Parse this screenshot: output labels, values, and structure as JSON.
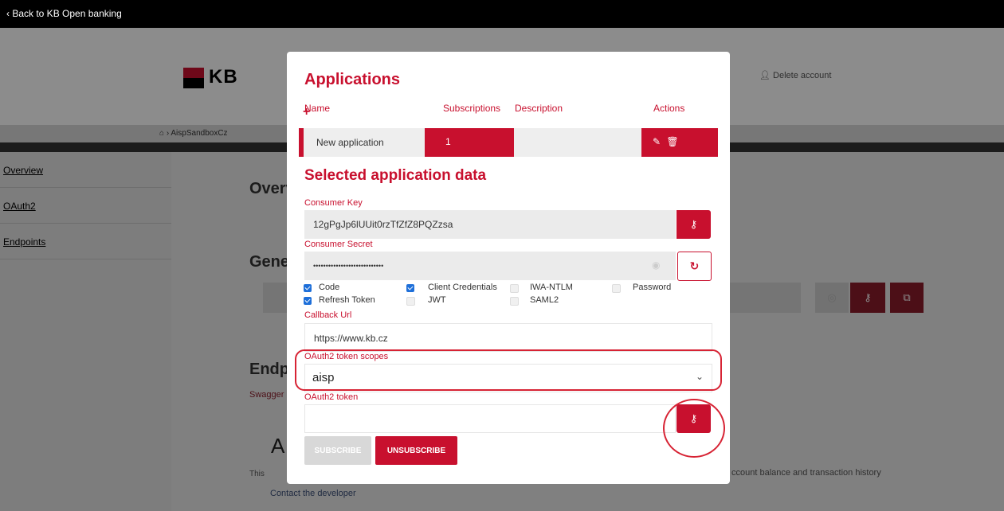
{
  "topbar": {
    "back_label": "‹ Back to KB Open banking"
  },
  "header": {
    "logo_text": "KB",
    "delete_account_label": "Delete account"
  },
  "breadcrumb": {
    "current": "AispSandboxCz"
  },
  "sidebar": {
    "items": [
      {
        "label": "Overview"
      },
      {
        "label": "OAuth2"
      },
      {
        "label": "Endpoints"
      }
    ]
  },
  "background": {
    "overview_heading": "Overv",
    "general_heading": "Gener",
    "endpoints_heading": "Endpo",
    "swagger_text": "Swagger d",
    "api_heading": "A",
    "this_text": "This",
    "balance_text": "ccount balance and transaction history",
    "contact_link": "Contact the developer"
  },
  "modal": {
    "title": "Applications",
    "columns": {
      "name": "Name",
      "subscriptions": "Subscriptions",
      "description": "Description",
      "actions": "Actions"
    },
    "add_symbol": "+",
    "app_row": {
      "name": "New application",
      "subscriptions": "1",
      "description": ""
    },
    "selected_title": "Selected application data",
    "consumer_key_label": "Consumer Key",
    "consumer_key_value": "12gPgJp6lUUit0rzTfZfZ8PQZzsa",
    "consumer_secret_label": "Consumer Secret",
    "consumer_secret_value": "••••••••••••••••••••••••••••",
    "grant_types": [
      {
        "label": "Code",
        "checked": true
      },
      {
        "label": "Client Credentials",
        "checked": true
      },
      {
        "label": "IWA-NTLM",
        "checked": false
      },
      {
        "label": "Password",
        "checked": false
      },
      {
        "label": "Refresh Token",
        "checked": true
      },
      {
        "label": "JWT",
        "checked": false
      },
      {
        "label": "SAML2",
        "checked": false
      }
    ],
    "callback_label": "Callback Url",
    "callback_value": "https://www.kb.cz",
    "scopes_label": "OAuth2 token scopes",
    "scopes_value": "aisp",
    "token_label": "OAuth2 token",
    "token_value": "",
    "subscribe_label": "SUBSCRIBE",
    "unsubscribe_label": "UNSUBSCRIBE"
  },
  "colors": {
    "brand_red": "#c8102e",
    "highlight_ring": "#d72334",
    "checkbox_blue": "#1e6fd9"
  },
  "icons": {
    "key": "key-icon",
    "refresh": "refresh-icon",
    "edit": "pencil-icon",
    "delete": "trash-icon",
    "eye": "eye-icon",
    "copy": "copy-icon",
    "chevron": "chevron-down-icon",
    "home": "home-icon",
    "user": "user-icon"
  }
}
